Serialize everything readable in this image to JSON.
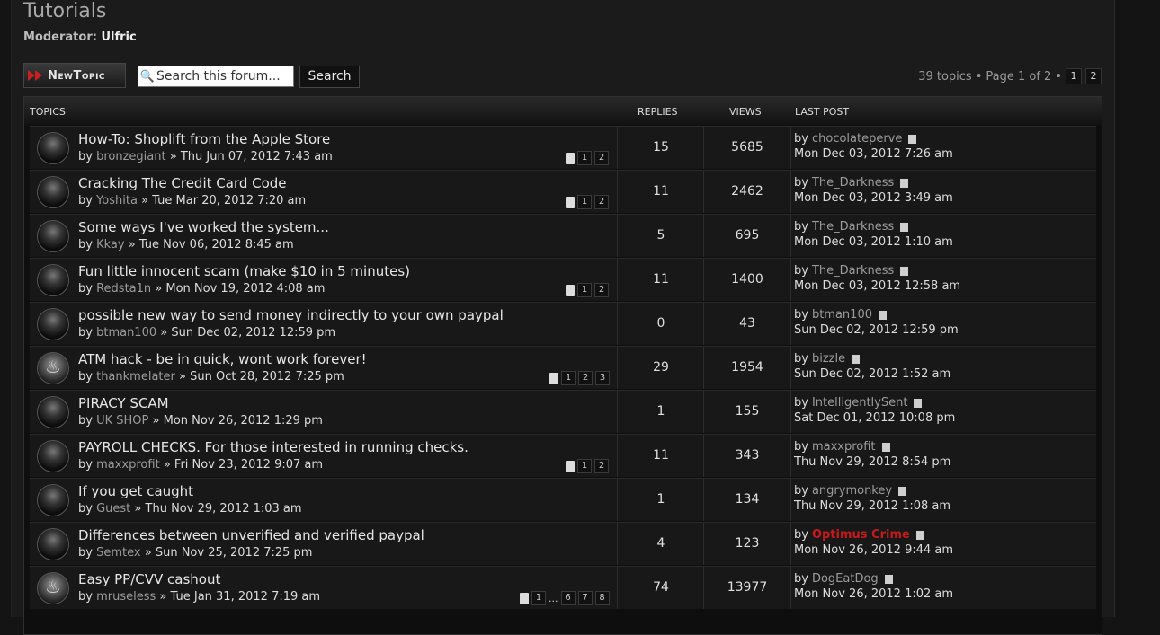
{
  "header": {
    "title": "Tutorials",
    "moderator_label": "Moderator:",
    "moderator_name": "Ulfric"
  },
  "toolbar": {
    "new_topic_label": "NewTopic",
    "search_placeholder": "Search this forum...",
    "search_button": "Search",
    "topic_count": "39 topics",
    "page_info": "Page 1 of 2",
    "bullet": "•",
    "pages": [
      "1",
      "2"
    ]
  },
  "columns": {
    "topics": "TOPICS",
    "replies": "REPLIES",
    "views": "VIEWS",
    "last_post": "LAST POST"
  },
  "colors": {
    "accent_red": "#c51a1a",
    "muted_link": "#9c9c9c"
  },
  "topics": [
    {
      "icon": "dark-orb-icon",
      "title": "How-To: Shoplift from the Apple Store",
      "by": "by",
      "author": "bronzegiant",
      "sep": "»",
      "date": "Thu Jun 07, 2012 7:43 am",
      "pages": [
        "1",
        "2"
      ],
      "replies": "15",
      "views": "5685",
      "last_by": "by",
      "last_user": "chocolateperve",
      "last_date": "Mon Dec 03, 2012 7:26 am"
    },
    {
      "icon": "dark-orb-icon",
      "title": "Cracking The Credit Card Code",
      "by": "by",
      "author": "Yoshita",
      "sep": "»",
      "date": "Tue Mar 20, 2012 7:20 am",
      "pages": [
        "1",
        "2"
      ],
      "replies": "11",
      "views": "2462",
      "last_by": "by",
      "last_user": "The_Darkness",
      "last_date": "Mon Dec 03, 2012 3:49 am"
    },
    {
      "icon": "dark-orb-icon",
      "title": "Some ways I've worked the system...",
      "by": "by",
      "author": "Kkay",
      "sep": "»",
      "date": "Tue Nov 06, 2012 8:45 am",
      "pages": [],
      "replies": "5",
      "views": "695",
      "last_by": "by",
      "last_user": "The_Darkness",
      "last_date": "Mon Dec 03, 2012 1:10 am"
    },
    {
      "icon": "dark-orb-icon",
      "title": "Fun little innocent scam (make $10 in 5 minutes)",
      "by": "by",
      "author": "Redsta1n",
      "sep": "»",
      "date": "Mon Nov 19, 2012 4:08 am",
      "pages": [
        "1",
        "2"
      ],
      "replies": "11",
      "views": "1400",
      "last_by": "by",
      "last_user": "The_Darkness",
      "last_date": "Mon Dec 03, 2012 12:58 am"
    },
    {
      "icon": "dark-orb-icon",
      "title": "possible new way to send money indirectly to your own paypal",
      "by": "by",
      "author": "btman100",
      "sep": "»",
      "date": "Sun Dec 02, 2012 12:59 pm",
      "pages": [],
      "replies": "0",
      "views": "43",
      "last_by": "by",
      "last_user": "btman100",
      "last_date": "Sun Dec 02, 2012 12:59 pm"
    },
    {
      "icon": "hot-topic-icon",
      "title": "ATM hack - be in quick, wont work forever!",
      "by": "by",
      "author": "thankmelater",
      "sep": "»",
      "date": "Sun Oct 28, 2012 7:25 pm",
      "pages": [
        "1",
        "2",
        "3"
      ],
      "replies": "29",
      "views": "1954",
      "last_by": "by",
      "last_user": "bizzle",
      "last_date": "Sun Dec 02, 2012 1:52 am"
    },
    {
      "icon": "dark-orb-icon",
      "title": "PIRACY SCAM",
      "by": "by",
      "author": "UK SHOP",
      "sep": "»",
      "date": "Mon Nov 26, 2012 1:29 pm",
      "pages": [],
      "replies": "1",
      "views": "155",
      "last_by": "by",
      "last_user": "IntelligentlySent",
      "last_date": "Sat Dec 01, 2012 10:08 pm"
    },
    {
      "icon": "dark-orb-icon",
      "title": "PAYROLL CHECKS. For those interested in running checks.",
      "by": "by",
      "author": "maxxprofit",
      "sep": "»",
      "date": "Fri Nov 23, 2012 9:07 am",
      "pages": [
        "1",
        "2"
      ],
      "replies": "11",
      "views": "343",
      "last_by": "by",
      "last_user": "maxxprofit",
      "last_date": "Thu Nov 29, 2012 8:54 pm"
    },
    {
      "icon": "dark-orb-icon",
      "title": "If you get caught",
      "by": "by",
      "author": "Guest",
      "sep": "»",
      "date": "Thu Nov 29, 2012 1:03 am",
      "pages": [],
      "replies": "1",
      "views": "134",
      "last_by": "by",
      "last_user": "angrymonkey",
      "last_date": "Thu Nov 29, 2012 1:08 am"
    },
    {
      "icon": "dark-orb-icon",
      "title": "Differences between unverified and verified paypal",
      "by": "by",
      "author": "Semtex",
      "sep": "»",
      "date": "Sun Nov 25, 2012 7:25 pm",
      "pages": [],
      "replies": "4",
      "views": "123",
      "last_by": "by",
      "last_user": "Optimus Crime",
      "last_user_style": "red",
      "last_date": "Mon Nov 26, 2012 9:44 am"
    },
    {
      "icon": "hot-topic-icon",
      "title": "Easy PP/CVV cashout",
      "by": "by",
      "author": "mruseless",
      "sep": "»",
      "date": "Tue Jan 31, 2012 7:19 am",
      "pages": [
        "1",
        "...",
        "6",
        "7",
        "8"
      ],
      "replies": "74",
      "views": "13977",
      "last_by": "by",
      "last_user": "DogEatDog",
      "last_date": "Mon Nov 26, 2012 1:02 am"
    }
  ]
}
